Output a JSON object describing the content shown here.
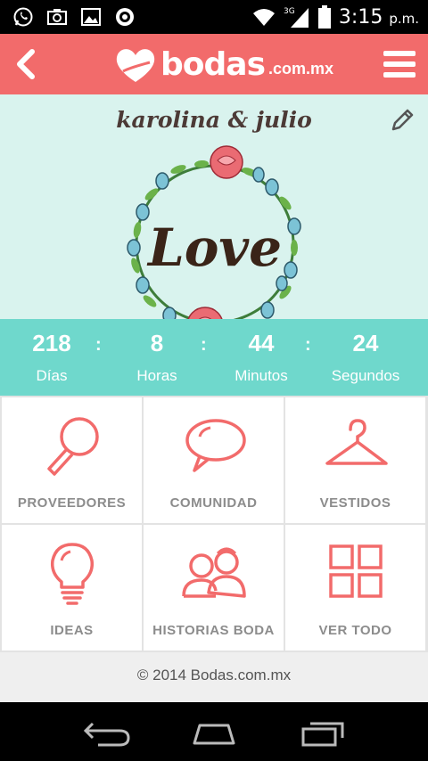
{
  "status_bar": {
    "icons": [
      "whatsapp-icon",
      "camera-icon",
      "gallery-icon",
      "settings-icon",
      "wifi-icon",
      "signal-3g-icon",
      "battery-icon"
    ],
    "network": "3G",
    "time": "3:15",
    "ampm": "p.m."
  },
  "header": {
    "logo_text": "bodas",
    "logo_suffix": ".com.mx",
    "back_icon": "chevron-left-icon",
    "menu_icon": "hamburger-menu-icon",
    "color": "#f26b6b"
  },
  "hero": {
    "couple_names": "karolina & julio",
    "love_text": "Love",
    "edit_icon": "pencil-icon",
    "background": "#d9f3ee"
  },
  "countdown": {
    "background": "#6fd8cc",
    "units": [
      {
        "value": "218",
        "label": "Días"
      },
      {
        "value": "8",
        "label": "Horas"
      },
      {
        "value": "44",
        "label": "Minutos"
      },
      {
        "value": "24",
        "label": "Segundos"
      }
    ],
    "separator": ":"
  },
  "grid": {
    "icon_color": "#f26b6b",
    "tiles": [
      {
        "label": "PROVEEDORES",
        "icon": "magnifier-icon"
      },
      {
        "label": "COMUNIDAD",
        "icon": "speech-bubble-icon"
      },
      {
        "label": "VESTIDOS",
        "icon": "hanger-icon"
      },
      {
        "label": "IDEAS",
        "icon": "lightbulb-icon"
      },
      {
        "label": "HISTORIAS BODA",
        "icon": "couple-icon"
      },
      {
        "label": "VER TODO",
        "icon": "grid-icon"
      }
    ]
  },
  "footer": {
    "text": "© 2014 Bodas.com.mx"
  },
  "navbar": {
    "buttons": [
      "back-nav-icon",
      "home-nav-icon",
      "recents-nav-icon"
    ]
  }
}
